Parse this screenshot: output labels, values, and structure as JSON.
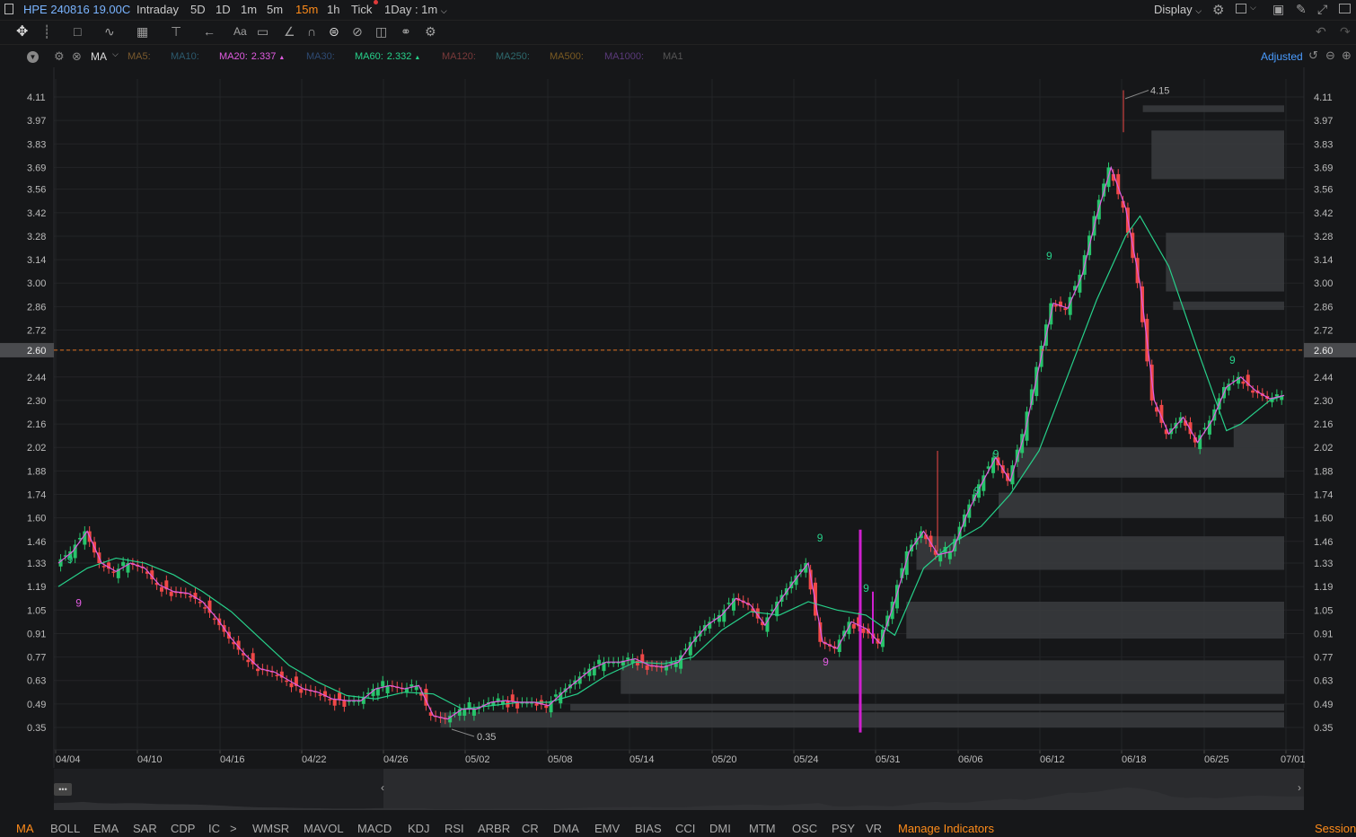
{
  "topbar": {
    "symbol": "HPE 240816 19.00C",
    "timeframes": [
      "Intraday",
      "5D",
      "1D",
      "1m",
      "5m",
      "15m",
      "1h",
      "Tick"
    ],
    "active_timeframe": "15m",
    "interval_select": "1Day : 1m",
    "display_label": "Display"
  },
  "toolbar": {
    "text_tool_label": "Aa"
  },
  "indicator_bar": {
    "main_label": "MA",
    "adjusted_label": "Adjusted",
    "items": [
      {
        "label": "MA5:",
        "value": "",
        "color": "#7a5a2e"
      },
      {
        "label": "MA10:",
        "value": "",
        "color": "#2c5a6e"
      },
      {
        "label": "MA20:",
        "value": "2.337",
        "color": "#e05ce0"
      },
      {
        "label": "MA30:",
        "value": "",
        "color": "#2e4a72"
      },
      {
        "label": "MA60:",
        "value": "2.332",
        "color": "#27d08a"
      },
      {
        "label": "MA120:",
        "value": "",
        "color": "#7a3a3a"
      },
      {
        "label": "MA250:",
        "value": "",
        "color": "#2e6a6e"
      },
      {
        "label": "MA500:",
        "value": "",
        "color": "#7a5a22"
      },
      {
        "label": "MA1000:",
        "value": "",
        "color": "#5a3a7a"
      },
      {
        "label": "MA1",
        "value": "",
        "color": "#555555"
      }
    ]
  },
  "chart_data": {
    "type": "candlestick",
    "y_ticks": [
      4.11,
      3.97,
      3.83,
      3.69,
      3.56,
      3.42,
      3.28,
      3.14,
      3.0,
      2.86,
      2.72,
      2.6,
      2.44,
      2.3,
      2.16,
      2.02,
      1.88,
      1.74,
      1.6,
      1.46,
      1.33,
      1.19,
      1.05,
      0.91,
      0.77,
      0.63,
      0.49,
      0.35
    ],
    "y_tick_labels": [
      "4.11",
      "3.97",
      "3.83",
      "3.69",
      "3.56",
      "3.42",
      "3.28",
      "3.14",
      "3.00",
      "2.86",
      "2.72",
      "2.60",
      "2.44",
      "2.30",
      "2.16",
      "2.02",
      "1.88",
      "1.74",
      "1.60",
      "1.46",
      "1.33",
      "1.19",
      "1.05",
      "0.91",
      "0.77",
      "0.63",
      "0.49",
      "0.35"
    ],
    "ylim": [
      0.35,
      4.11
    ],
    "x_labels": [
      "04/04",
      "04/10",
      "04/16",
      "04/22",
      "04/26",
      "05/02",
      "05/08",
      "05/14",
      "05/20",
      "05/24",
      "05/31",
      "06/06",
      "06/12",
      "06/18",
      "06/25",
      "07/01"
    ],
    "current_price": 2.6,
    "current_price_label": "2.60",
    "high_label": "4.15",
    "high_value": 4.15,
    "low_label": "0.35",
    "low_value": 0.35,
    "ma20_series": [
      [
        0,
        1.33
      ],
      [
        1,
        1.4
      ],
      [
        2,
        1.52
      ],
      [
        3,
        1.33
      ],
      [
        4,
        1.28
      ],
      [
        5,
        1.33
      ],
      [
        6,
        1.3
      ],
      [
        7,
        1.2
      ],
      [
        8,
        1.16
      ],
      [
        9,
        1.15
      ],
      [
        10,
        1.1
      ],
      [
        11,
        1.0
      ],
      [
        12,
        0.88
      ],
      [
        13,
        0.78
      ],
      [
        14,
        0.7
      ],
      [
        15,
        0.68
      ],
      [
        16,
        0.63
      ],
      [
        17,
        0.58
      ],
      [
        18,
        0.56
      ],
      [
        19,
        0.52
      ],
      [
        20,
        0.51
      ],
      [
        21,
        0.51
      ],
      [
        22,
        0.58
      ],
      [
        23,
        0.6
      ],
      [
        24,
        0.58
      ],
      [
        25,
        0.6
      ],
      [
        26,
        0.42
      ],
      [
        27,
        0.4
      ],
      [
        28,
        0.46
      ],
      [
        29,
        0.46
      ],
      [
        30,
        0.5
      ],
      [
        31,
        0.51
      ],
      [
        32,
        0.5
      ],
      [
        33,
        0.5
      ],
      [
        34,
        0.48
      ],
      [
        35,
        0.56
      ],
      [
        36,
        0.63
      ],
      [
        37,
        0.7
      ],
      [
        38,
        0.74
      ],
      [
        39,
        0.74
      ],
      [
        40,
        0.76
      ],
      [
        41,
        0.72
      ],
      [
        42,
        0.71
      ],
      [
        43,
        0.74
      ],
      [
        44,
        0.86
      ],
      [
        45,
        0.96
      ],
      [
        46,
        1.02
      ],
      [
        47,
        1.12
      ],
      [
        48,
        1.08
      ],
      [
        49,
        0.96
      ],
      [
        50,
        1.1
      ],
      [
        51,
        1.22
      ],
      [
        52,
        1.33
      ],
      [
        53,
        0.86
      ],
      [
        54,
        0.82
      ],
      [
        55,
        0.98
      ],
      [
        56,
        0.94
      ],
      [
        57,
        0.85
      ],
      [
        58,
        1.1
      ],
      [
        59,
        1.4
      ],
      [
        60,
        1.52
      ],
      [
        61,
        1.38
      ],
      [
        62,
        1.4
      ],
      [
        63,
        1.62
      ],
      [
        64,
        1.8
      ],
      [
        65,
        1.96
      ],
      [
        66,
        1.82
      ],
      [
        67,
        2.1
      ],
      [
        68,
        2.5
      ],
      [
        69,
        2.88
      ],
      [
        70,
        2.85
      ],
      [
        71,
        3.05
      ],
      [
        72,
        3.4
      ],
      [
        73,
        3.69
      ],
      [
        74,
        3.45
      ],
      [
        75,
        3.0
      ],
      [
        76,
        2.3
      ],
      [
        77,
        2.1
      ],
      [
        78,
        2.2
      ],
      [
        79,
        2.05
      ],
      [
        80,
        2.18
      ],
      [
        81,
        2.38
      ],
      [
        82,
        2.44
      ],
      [
        83,
        2.36
      ],
      [
        84,
        2.31
      ],
      [
        85,
        2.33
      ]
    ],
    "ma60_series": [
      [
        0,
        1.19
      ],
      [
        2,
        1.3
      ],
      [
        4,
        1.36
      ],
      [
        6,
        1.33
      ],
      [
        8,
        1.26
      ],
      [
        10,
        1.16
      ],
      [
        12,
        1.04
      ],
      [
        14,
        0.88
      ],
      [
        16,
        0.72
      ],
      [
        18,
        0.62
      ],
      [
        20,
        0.54
      ],
      [
        22,
        0.52
      ],
      [
        24,
        0.56
      ],
      [
        26,
        0.55
      ],
      [
        28,
        0.46
      ],
      [
        30,
        0.48
      ],
      [
        32,
        0.5
      ],
      [
        34,
        0.5
      ],
      [
        36,
        0.55
      ],
      [
        38,
        0.66
      ],
      [
        40,
        0.74
      ],
      [
        42,
        0.73
      ],
      [
        44,
        0.77
      ],
      [
        46,
        0.93
      ],
      [
        48,
        1.04
      ],
      [
        50,
        1.02
      ],
      [
        52,
        1.1
      ],
      [
        54,
        1.05
      ],
      [
        56,
        1.02
      ],
      [
        58,
        0.9
      ],
      [
        60,
        1.3
      ],
      [
        62,
        1.45
      ],
      [
        64,
        1.55
      ],
      [
        66,
        1.74
      ],
      [
        68,
        2.0
      ],
      [
        70,
        2.45
      ],
      [
        72,
        2.9
      ],
      [
        74,
        3.28
      ],
      [
        75,
        3.4
      ],
      [
        77,
        3.1
      ],
      [
        79,
        2.6
      ],
      [
        81,
        2.12
      ],
      [
        82,
        2.16
      ],
      [
        84,
        2.3
      ],
      [
        85,
        2.33
      ]
    ],
    "zones": [
      {
        "y1": 4.02,
        "y2": 4.06,
        "x_from": 75.2
      },
      {
        "y1": 3.62,
        "y2": 3.91,
        "x_from": 75.8
      },
      {
        "y1": 2.95,
        "y2": 3.3,
        "x_from": 76.8
      },
      {
        "y1": 2.84,
        "y2": 2.89,
        "x_from": 77.3
      },
      {
        "y1": 2.02,
        "y2": 2.16,
        "x_from": 81.5
      },
      {
        "y1": 1.84,
        "y2": 2.02,
        "x_from": 66.5
      },
      {
        "y1": 1.6,
        "y2": 1.75,
        "x_from": 65.2
      },
      {
        "y1": 1.29,
        "y2": 1.49,
        "x_from": 59.5
      },
      {
        "y1": 0.88,
        "y2": 1.1,
        "x_from": 58.8
      },
      {
        "y1": 0.55,
        "y2": 0.75,
        "x_from": 39.0
      },
      {
        "y1": 0.45,
        "y2": 0.49,
        "x_from": 35.5
      },
      {
        "y1": 0.35,
        "y2": 0.44,
        "x_from": 26.5
      }
    ],
    "td_labels": [
      {
        "x": 0.6,
        "y": 1.33,
        "t": "9",
        "c": "#27d08a"
      },
      {
        "x": 1.2,
        "y": 1.07,
        "t": "9",
        "c": "#e05ce0"
      },
      {
        "x": 52.6,
        "y": 1.46,
        "t": "9",
        "c": "#27d08a"
      },
      {
        "x": 55.8,
        "y": 1.16,
        "t": "9",
        "c": "#27d08a"
      },
      {
        "x": 53.0,
        "y": 0.72,
        "t": "9",
        "c": "#e05ce0"
      },
      {
        "x": 63.5,
        "y": 1.74,
        "t": "9",
        "c": "#27d08a"
      },
      {
        "x": 64.8,
        "y": 1.96,
        "t": "9",
        "c": "#27d08a"
      },
      {
        "x": 68.5,
        "y": 3.14,
        "t": "9",
        "c": "#27d08a"
      },
      {
        "x": 81.2,
        "y": 2.52,
        "t": "9",
        "c": "#27d08a"
      }
    ]
  },
  "bottombar": {
    "indicators": [
      "MA",
      "BOLL",
      "EMA",
      "SAR",
      "CDP",
      "IC",
      "WMSR",
      "MAVOL",
      "MACD",
      "KDJ",
      "RSI",
      "ARBR",
      "CR",
      "DMA",
      "EMV",
      "BIAS",
      "CCI",
      "DMI",
      "MTM",
      "OSC",
      "PSY",
      "VR"
    ],
    "active_indicator": "MA",
    "more_symbol": ">",
    "manage_label": "Manage Indicators",
    "session_label": "Session"
  },
  "navigator": {
    "handle_left": "‹",
    "handle_right": "›",
    "menu_glyph": "•••"
  }
}
